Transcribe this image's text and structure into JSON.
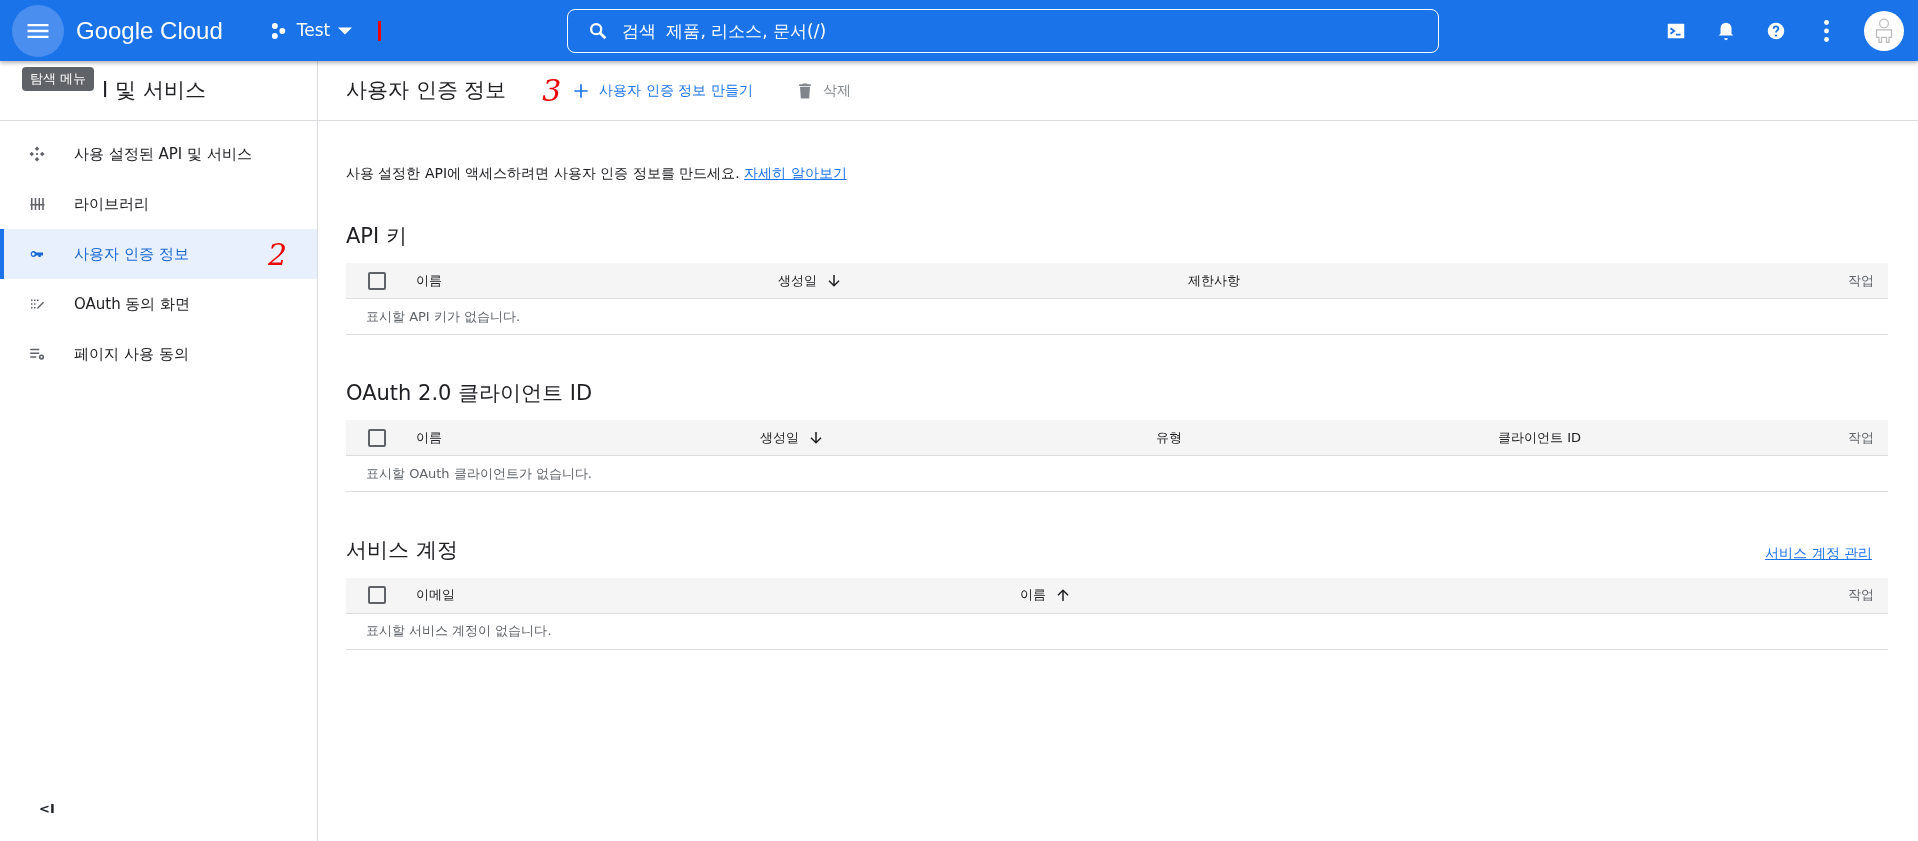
{
  "top_bar": {
    "menu_tooltip": "탐색 메뉴",
    "logo": "Google Cloud",
    "project": "Test",
    "search": {
      "placeholder": "검색  제품, 리소스, 문서(/)"
    }
  },
  "sidebar": {
    "title": "I 및 서비스",
    "items": [
      {
        "label": "사용 설정된 API 및 서비스",
        "selected": false
      },
      {
        "label": "라이브러리",
        "selected": false
      },
      {
        "label": "사용자 인증 정보",
        "selected": true
      },
      {
        "label": "OAuth 동의 화면",
        "selected": false
      },
      {
        "label": "페이지 사용 동의",
        "selected": false
      }
    ],
    "collapse": "<I"
  },
  "page": {
    "title": "사용자 인증 정보",
    "actions": [
      {
        "label": "사용자 인증 정보 만들기",
        "kind": "create",
        "disabled": false
      },
      {
        "label": "삭제",
        "kind": "delete",
        "disabled": true
      }
    ],
    "description": "사용 설정한 API에 액세스하려면 사용자 인증 정보를 만드세요.",
    "learn_more": "자세히 알아보기",
    "sections": [
      {
        "title": "API 키",
        "columns": [
          {
            "label": "이름"
          },
          {
            "label": "생성일",
            "sorted": true,
            "ascending": false
          },
          {
            "label": "제한사항"
          },
          {
            "label": "작업",
            "kind": "action"
          }
        ],
        "empty": "표시할 API 키가 없습니다.",
        "checked": false
      },
      {
        "title": "OAuth 2.0 클라이언트 ID",
        "columns": [
          {
            "label": "이름"
          },
          {
            "label": "생성일",
            "sorted": true,
            "ascending": false
          },
          {
            "label": "유형"
          },
          {
            "label": "클라이언트 ID"
          },
          {
            "label": "작업",
            "kind": "action"
          }
        ],
        "empty": "표시할 OAuth 클라이언트가 없습니다.",
        "checked": false
      },
      {
        "title": "서비스 계정",
        "link": "서비스 계정 관리",
        "columns": [
          {
            "label": "이메일"
          },
          {
            "label": "이름",
            "sorted": true,
            "ascending": true
          },
          {
            "label": "작업",
            "kind": "action"
          }
        ],
        "empty": "표시할 서비스 계정이 없습니다.",
        "checked": false
      }
    ]
  },
  "annotations": [
    {
      "text": "3"
    },
    {
      "text": "2"
    }
  ]
}
